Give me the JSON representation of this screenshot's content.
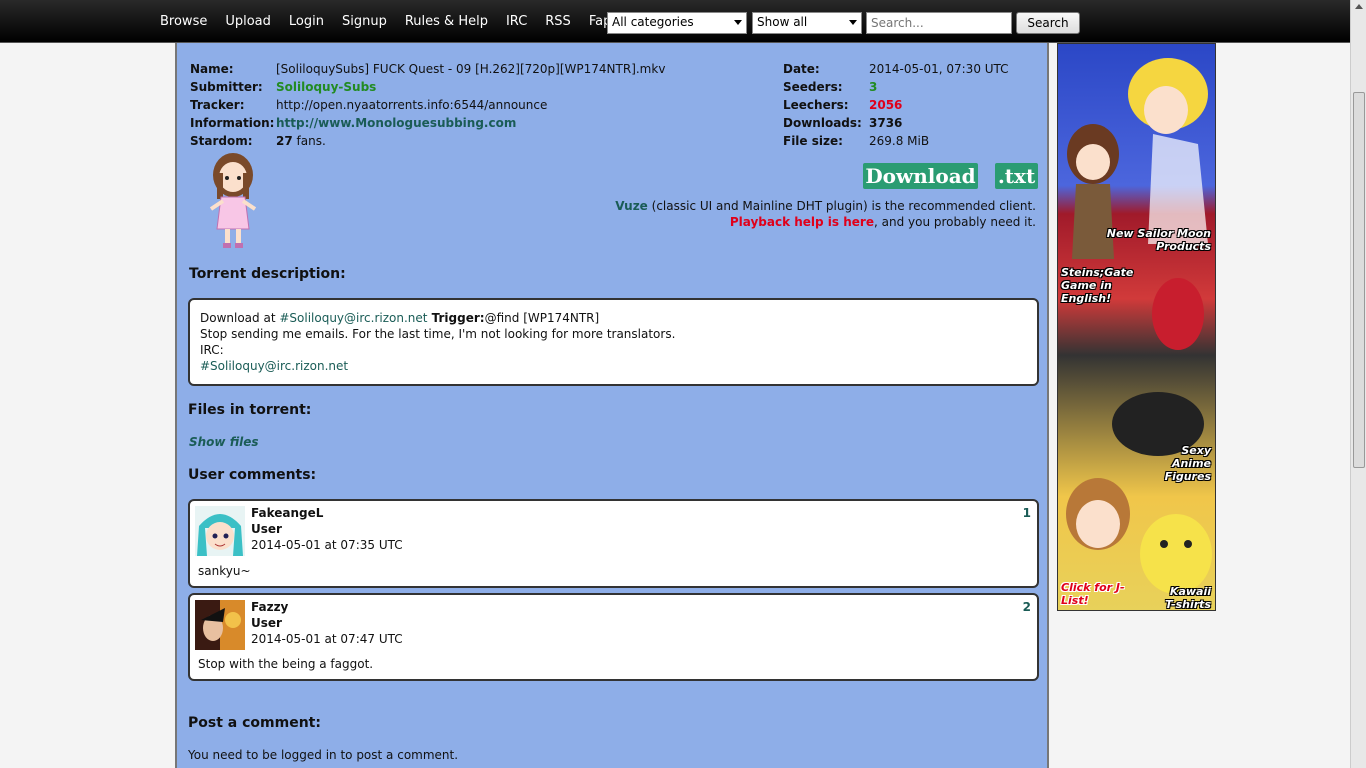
{
  "nav": {
    "links": [
      "Browse",
      "Upload",
      "Login",
      "Signup",
      "Rules & Help",
      "IRC",
      "RSS",
      "Fap"
    ],
    "category_select": "All categories",
    "filter_select": "Show all",
    "search_placeholder": "Search...",
    "search_button": "Search"
  },
  "torrent": {
    "labels": {
      "name": "Name:",
      "submitter": "Submitter:",
      "tracker": "Tracker:",
      "information": "Information:",
      "stardom": "Stardom:",
      "date": "Date:",
      "seeders": "Seeders:",
      "leechers": "Leechers:",
      "downloads": "Downloads:",
      "filesize": "File size:"
    },
    "name": "[SoliloquySubs] FUCK Quest - 09 [H.262][720p][WP174NTR].mkv",
    "submitter": "Soliloquy-Subs",
    "tracker": "http://open.nyaatorrents.info:6544/announce",
    "information": "http://www.Monologuesubbing.com",
    "stardom_count": "27",
    "stardom_suffix": " fans.",
    "date": "2014-05-01, 07:30 UTC",
    "seeders": "3",
    "leechers": "2056",
    "downloads": "3736",
    "filesize": "269.8 MiB"
  },
  "buttons": {
    "download": "Download",
    "txt": ".txt"
  },
  "client_note": {
    "vuze": "Vuze",
    "vuze_rest": " (classic UI and Mainline DHT plugin) is the recommended client.",
    "playback": "Playback help is here",
    "playback_rest": ", and you probably need it."
  },
  "description": {
    "heading": "Torrent description:",
    "line1_pre": "Download at ",
    "line1_link": "#Soliloquy@irc.rizon.net",
    "line1_trigger": " Trigger:",
    "line1_post": "@find [WP174NTR]",
    "line2": "Stop sending me emails. For the last time, I'm not looking for more translators.",
    "line3": "IRC:",
    "line4": "#Soliloquy@irc.rizon.net"
  },
  "files": {
    "heading": "Files in torrent:",
    "show": "Show files"
  },
  "comments": {
    "heading": "User comments:",
    "items": [
      {
        "user": "FakeangeL",
        "role": "User",
        "time": "2014-05-01 at 07:35 UTC",
        "text": "sankyu~",
        "num": "1"
      },
      {
        "user": "Fazzy",
        "role": "User",
        "time": "2014-05-01 at 07:47 UTC",
        "text": "Stop with the being a faggot.",
        "num": "2"
      }
    ]
  },
  "post": {
    "heading": "Post a comment:",
    "note": "You need to be logged in to post a comment."
  },
  "banner": {
    "t1": "New Sailor Moon Products",
    "t2": "Steins;Gate Game in English!",
    "t3": "Sexy Anime Figures",
    "t4": "Click for J-List!",
    "t5": "Kawaii T-shirts"
  }
}
